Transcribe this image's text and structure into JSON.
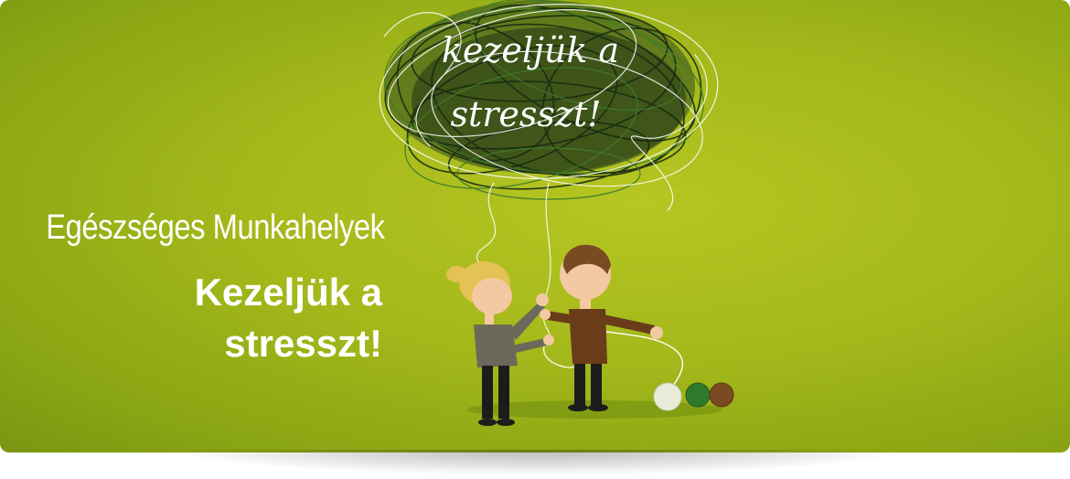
{
  "banner": {
    "subtitle": "Egészséges Munkahelyek",
    "headline_line1": "Kezeljük a",
    "headline_line2": "stresszt!"
  },
  "illustration": {
    "script_line1": "kezeljük a",
    "script_line2": "stresszt!"
  },
  "colors": {
    "background": "#a3b81a",
    "text": "#ffffff",
    "tangle": "#1f3a1a",
    "yarn_white": "#e8ecd8",
    "yarn_green": "#2e7a2a",
    "yarn_brown": "#7a4a22"
  }
}
